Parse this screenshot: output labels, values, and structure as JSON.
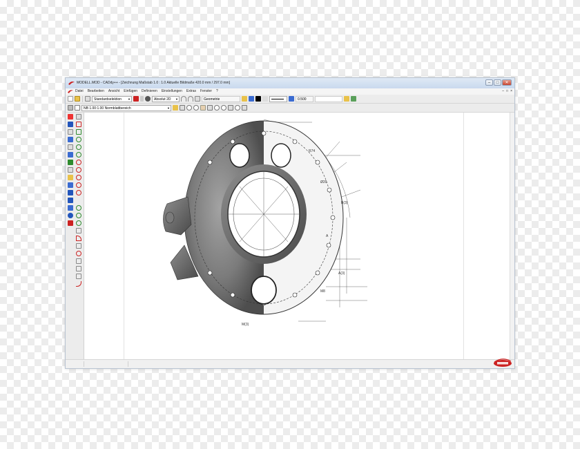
{
  "window": {
    "title": "MODELL.MOD  -  CADdy++ - [Zeichnung   Maßstab 1.0 : 1.0   Aktuelle Bildmaße 420.0 mm / 297.0 mm]",
    "controls": [
      "–",
      "□",
      "✕"
    ]
  },
  "menu": {
    "items": [
      "Datei",
      "Bearbeiten",
      "Ansicht",
      "Einfügen",
      "Definieren",
      "Einstellungen",
      "Extras",
      "Fenster",
      "?"
    ],
    "right_controls": [
      "–",
      "□",
      "×"
    ]
  },
  "toolbar1": {
    "selection_mode": "Standardselektion",
    "coordinate_mode": "Absolut 2D",
    "layer": "Geometrie",
    "line_width": "0.500"
  },
  "toolbar2": {
    "sheet_area": "NB 1.00:1.00 Normblattbereich"
  },
  "colors": {
    "accent_red": "#cc2222",
    "tool_green": "#2e8b2e",
    "tool_blue": "#2255bb"
  },
  "icons": {
    "drawing": "mechanical-housing-drawing",
    "brand": "brand-logo"
  }
}
